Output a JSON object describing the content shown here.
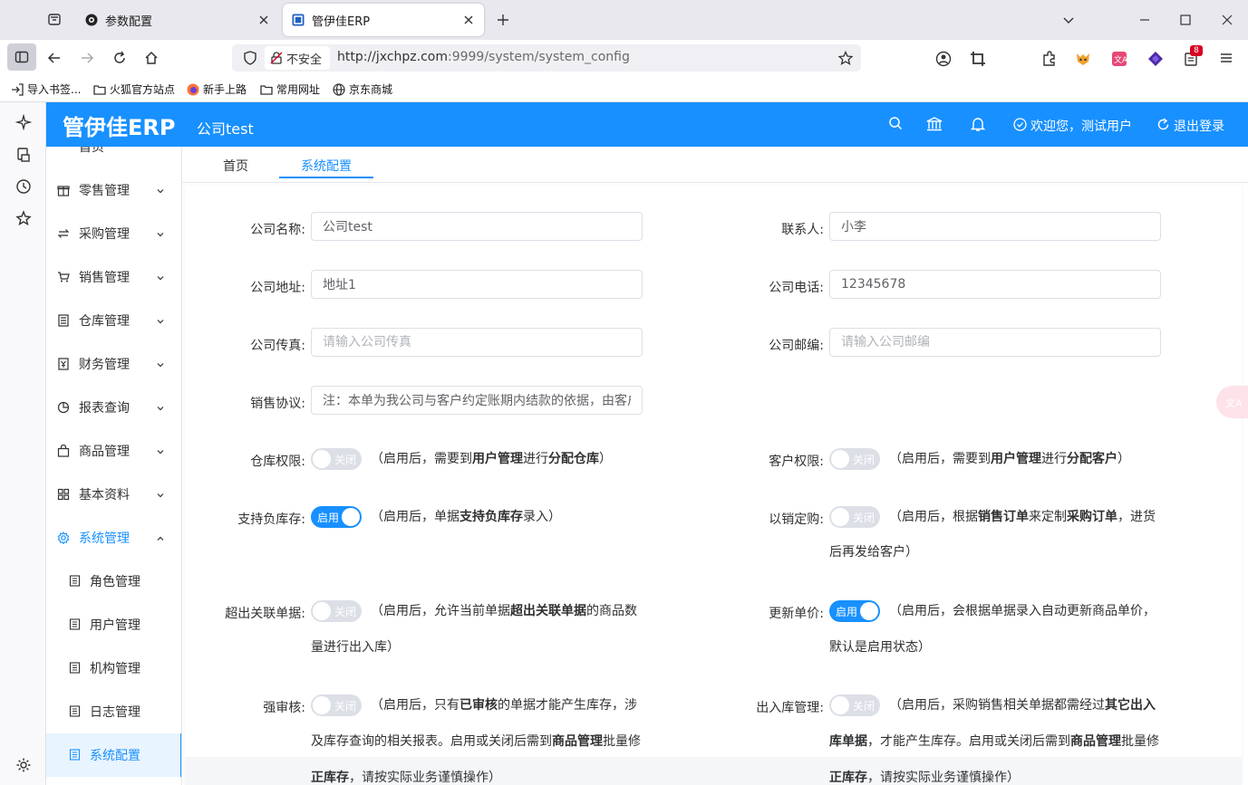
{
  "browser": {
    "tabs": [
      {
        "title": "参数配置"
      },
      {
        "title": "管伊佳ERP"
      }
    ],
    "security_label": "不安全",
    "url_host": "http://jxchpz.com",
    "url_path": ":9999/system/system_config",
    "extension_badge": "8",
    "bookmarks": [
      {
        "label": "导入书签...",
        "icon": "import-icon"
      },
      {
        "label": "火狐官方站点",
        "icon": "folder-icon"
      },
      {
        "label": "新手上路",
        "icon": "firefox-icon"
      },
      {
        "label": "常用网址",
        "icon": "folder-icon"
      },
      {
        "label": "京东商城",
        "icon": "globe-icon"
      }
    ]
  },
  "header": {
    "logo": "管伊佳ERP",
    "company": "公司test",
    "welcome": "欢迎您，测试用户",
    "logout": "退出登录",
    "color": "#1890ff"
  },
  "sidebar": {
    "partial_item": "首页",
    "items": [
      {
        "label": "零售管理",
        "icon": "gift-icon"
      },
      {
        "label": "采购管理",
        "icon": "swap-icon"
      },
      {
        "label": "销售管理",
        "icon": "cart-icon"
      },
      {
        "label": "仓库管理",
        "icon": "ledger-icon"
      },
      {
        "label": "财务管理",
        "icon": "money-icon"
      },
      {
        "label": "报表查询",
        "icon": "pie-icon"
      },
      {
        "label": "商品管理",
        "icon": "bag-icon"
      },
      {
        "label": "基本资料",
        "icon": "grid-icon"
      },
      {
        "label": "系统管理",
        "icon": "gear-icon"
      }
    ],
    "subitems": [
      {
        "label": "角色管理"
      },
      {
        "label": "用户管理"
      },
      {
        "label": "机构管理"
      },
      {
        "label": "日志管理"
      },
      {
        "label": "系统配置"
      }
    ]
  },
  "page_tabs": [
    {
      "label": "首页"
    },
    {
      "label": "系统配置"
    }
  ],
  "form": {
    "company_name": {
      "label": "公司名称:",
      "value": "公司test"
    },
    "contact": {
      "label": "联系人:",
      "value": "小李"
    },
    "address": {
      "label": "公司地址:",
      "value": "地址1"
    },
    "phone": {
      "label": "公司电话:",
      "value": "12345678"
    },
    "fax": {
      "label": "公司传真:",
      "placeholder": "请输入公司传真"
    },
    "zip": {
      "label": "公司邮编:",
      "placeholder": "请输入公司邮编"
    },
    "sales_agreement": {
      "label": "销售协议:",
      "value": "注：本单为我公司与客户约定账期内结款的依据，由客户或其单位员工签字生效，并承担法律责任。"
    },
    "switches": {
      "warehouse_perm": {
        "label": "仓库权限:",
        "state": "关闭",
        "on": false,
        "hint": [
          "（启用后，需要到",
          "用户管理",
          "进行",
          "分配仓库",
          "）"
        ]
      },
      "customer_perm": {
        "label": "客户权限:",
        "state": "关闭",
        "on": false,
        "hint": [
          "（启用后，需要到",
          "用户管理",
          "进行",
          "分配客户",
          "）"
        ]
      },
      "negative_stock": {
        "label": "支持负库存:",
        "state": "启用",
        "on": true,
        "hint": [
          "（启用后，单据",
          "支持负库存",
          "录入）"
        ]
      },
      "sale_to_purchase": {
        "label": "以销定购:",
        "state": "关闭",
        "on": false,
        "hint": [
          "（启用后，根据",
          "销售订单",
          "来定制",
          "采购订单",
          "，进货",
          "后再发给客户）"
        ]
      },
      "exceed_link": {
        "label": "超出关联单据:",
        "state": "关闭",
        "on": false,
        "hint": [
          "（启用后，允许当前单据",
          "超出关联单据",
          "的商品数",
          "量进行出入库）"
        ]
      },
      "update_price": {
        "label": "更新单价:",
        "state": "启用",
        "on": true,
        "hint": [
          "（启用后，会根据单据录入自动更新商品单价，",
          "默认是启用状态）"
        ]
      },
      "strict_audit": {
        "label": "强审核:",
        "state": "关闭",
        "on": false,
        "hint": [
          "（启用后，只有",
          "已审核",
          "的单据才能产生库存，涉",
          "及库存查询的相关报表。启用或关闭后需到",
          "商品管理",
          "批量修",
          "正库存",
          "，请按实际业务谨慎操作）"
        ]
      },
      "inout_manage": {
        "label": "出入库管理:",
        "state": "关闭",
        "on": false,
        "hint": [
          "（启用后，采购销售相关单据都需经过",
          "其它出入",
          "库单据",
          "，才能产生库存。启用或关闭后需到",
          "商品管理",
          "批量修",
          "正库存",
          "，请按实际业务谨慎操作）"
        ]
      }
    }
  }
}
